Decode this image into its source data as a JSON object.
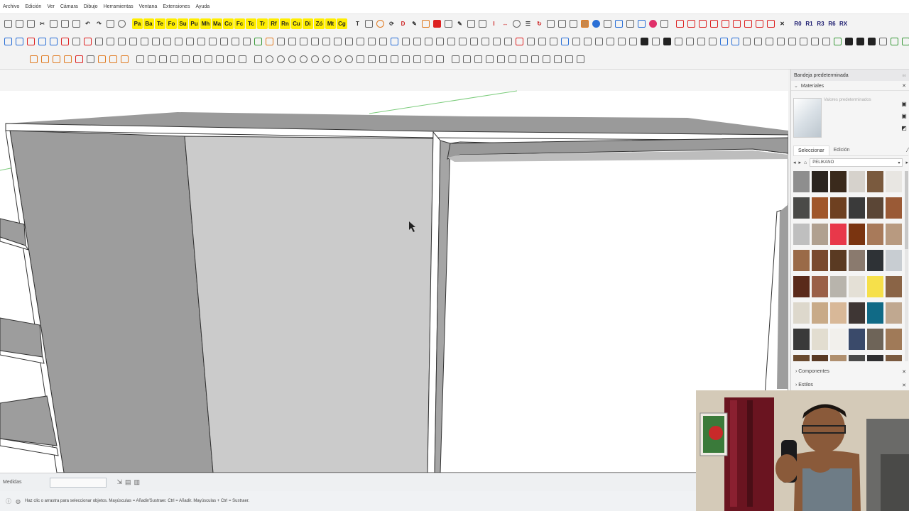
{
  "menu": [
    "Archivo",
    "Edición",
    "Ver",
    "Cámara",
    "Dibujo",
    "Herramientas",
    "Ventana",
    "Extensiones",
    "Ayuda"
  ],
  "toolbar_row1_yellow": [
    "Pa",
    "Ba",
    "Te",
    "Fo",
    "Su",
    "Pu",
    "Mh",
    "Ma",
    "Co",
    "Fc",
    "Tc",
    "Tr",
    "Rf",
    "Rn",
    "Cu",
    "Di",
    "Zó",
    "Mt",
    "Cg"
  ],
  "toolbar_row1_right": [
    "R0",
    "R1",
    "R3",
    "R6",
    "RX"
  ],
  "tray": {
    "title": "Bandeja predeterminada",
    "materials_label": "Materiales",
    "material_name_placeholder": "Valores predeterminados",
    "tab_select": "Seleccionar",
    "tab_edit": "Edición",
    "library": "PELIKANO",
    "components_label": "Componentes",
    "styles_label": "Estilos"
  },
  "swatch_colors": [
    "#8e8e8e",
    "#2a241f",
    "#3a2a1c",
    "#d6d2cc",
    "#7a5a3e",
    "#e8e6e2",
    "#4a4a48",
    "#a0562a",
    "#6e4020",
    "#3a3a3a",
    "#5b4636",
    "#9a5a36",
    "#bfbfbf",
    "#b0a090",
    "#e8384a",
    "#7a3410",
    "#a87a5a",
    "#b89a80",
    "#9a6a48",
    "#7a4a2e",
    "#5a3a22",
    "#8a7a6e",
    "#2e3236",
    "#c8cdd2",
    "#5a2a1a",
    "#9a6048",
    "#b8b4ac",
    "#e4e0d6",
    "#f6e04a",
    "#8a6446",
    "#ddd8cc",
    "#c8aa88",
    "#d8b898",
    "#3e3634",
    "#106a86",
    "#c0a890",
    "#3a3a3a",
    "#e2ddd0",
    "#f2f0ec",
    "#3a4a6a",
    "#6e6458",
    "#a07a58",
    "#6a4a2e",
    "#5a3a24",
    "#b09070",
    "#4a4a4a",
    "#2e2e30",
    "#7a5a40"
  ],
  "measure_label": "Medidas",
  "status_text": "Haz clic o arrastra para seleccionar objetos. Mayúsculas = Añadir/Sustraer. Ctrl = Añadir. Mayúsculas + Ctrl = Sustraer."
}
